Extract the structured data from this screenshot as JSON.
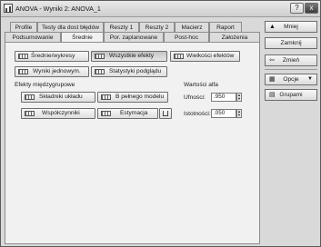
{
  "window": {
    "title": "ANOVA - Wyniki 2: ANOVA_1",
    "help": "?",
    "close": "x"
  },
  "tabs_row1": [
    "Profile",
    "Testy dla dost błędów",
    "Reszty 1",
    "Reszty 2",
    "Macierz",
    "Raport"
  ],
  "tabs_row2": [
    "Podsumowanie",
    "Średnie",
    "Por. zaplanowane",
    "Post-hoc",
    "Założenia"
  ],
  "buttons": {
    "srednie": "Średnie/wykresy",
    "wszystkie": "Wszystkie efekty",
    "wielkosci": "Wielkości efektów",
    "wyniki": "Wyniki jednowym.",
    "statystyki": "Statystyki podglądu",
    "skladniki": "Składniki układu",
    "b_pelnego": "B pełnego modelu",
    "wspolczynniki": "Współczynniki",
    "estymacja": "Estymacja"
  },
  "groups": {
    "efekty": "Efekty międzygrupowe",
    "alfa": "Wartości alfa"
  },
  "fields": {
    "ufnosci": {
      "label": "Ufności:",
      "value": ".950"
    },
    "istotnosci": {
      "label": "Istotności:",
      "value": ".050"
    }
  },
  "side": {
    "mniej": "Mniej",
    "zamknij": "Zamknij",
    "zmien": "Zmień",
    "opcje": "Opcje",
    "grupami": "Grupami"
  }
}
